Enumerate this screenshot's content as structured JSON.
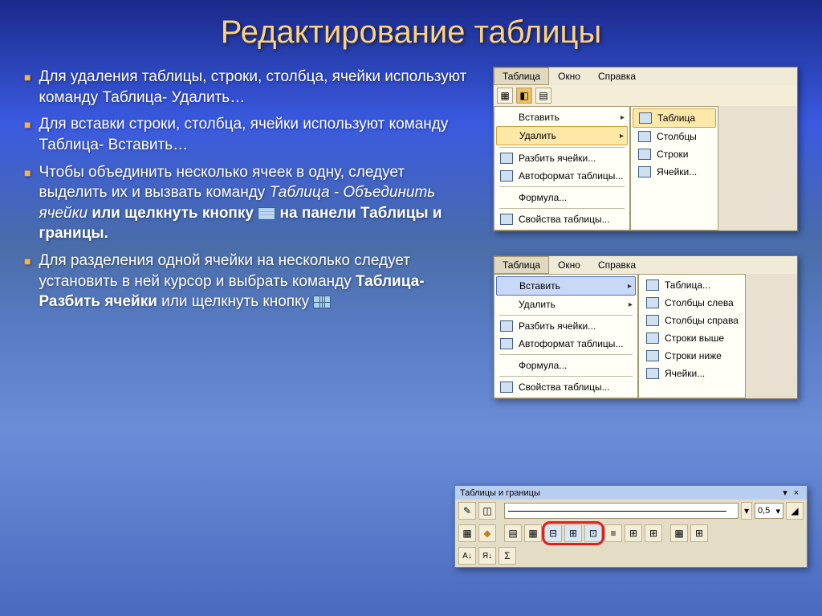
{
  "title": "Редактирование таблицы",
  "bullets": [
    {
      "text": "Для удаления таблицы, строки, столбца, ячейки используют команду Таблица- Удалить…"
    },
    {
      "text": "Для вставки строки, столбца, ячейки используют команду Таблица- Вставить…"
    },
    {
      "text_pre": "Чтобы объединить несколько ячеек в одну, следует выделить их и вызвать команду ",
      "italic": "Таблица - Объединить ячейки",
      "bold_mid": " или щелкнуть кнопку ",
      "icon": "merge",
      "bold_post": " на панели Таблицы и границы."
    },
    {
      "text_pre": "Для разделения одной ячейки на несколько следует установить в ней курсор и выбрать команду ",
      "bold_mid2": "Таблица- Разбить ячейки",
      "post": " или щелкнуть кнопку ",
      "icon": "split"
    }
  ],
  "panel1": {
    "menubar": [
      "Таблица",
      "Окно",
      "Справка"
    ],
    "active_menu": 0,
    "items": [
      {
        "label": "Вставить",
        "arrow": true
      },
      {
        "label": "Удалить",
        "arrow": true,
        "highlight": "highlight"
      },
      {
        "sep": true
      },
      {
        "label": "Разбить ячейки...",
        "icon": "⊞"
      },
      {
        "label": "Автоформат таблицы...",
        "icon": "▤"
      },
      {
        "sep": true
      },
      {
        "label": "Формула..."
      },
      {
        "sep": true
      },
      {
        "label": "Свойства таблицы...",
        "icon": "▦"
      }
    ],
    "submenu": [
      {
        "label": "Таблица",
        "icon": "▦",
        "highlight": "highlight"
      },
      {
        "label": "Столбцы",
        "icon": "⫿"
      },
      {
        "label": "Строки",
        "icon": "≡"
      },
      {
        "label": "Ячейки...",
        "icon": "▭"
      }
    ]
  },
  "panel2": {
    "menubar": [
      "Таблица",
      "Окно",
      "Справка"
    ],
    "active_menu": 0,
    "items": [
      {
        "label": "Вставить",
        "arrow": true,
        "highlight": "highlight-blue"
      },
      {
        "label": "Удалить",
        "arrow": true
      },
      {
        "sep": true
      },
      {
        "label": "Разбить ячейки...",
        "icon": "⊞"
      },
      {
        "label": "Автоформат таблицы...",
        "icon": "▤"
      },
      {
        "sep": true
      },
      {
        "label": "Формула..."
      },
      {
        "sep": true
      },
      {
        "label": "Свойства таблицы...",
        "icon": "▦"
      }
    ],
    "submenu": [
      {
        "label": "Таблица...",
        "icon": "▦"
      },
      {
        "label": "Столбцы слева",
        "icon": "⫿"
      },
      {
        "label": "Столбцы справа",
        "icon": "⫿"
      },
      {
        "label": "Строки выше",
        "icon": "≡"
      },
      {
        "label": "Строки ниже",
        "icon": "≡"
      },
      {
        "label": "Ячейки...",
        "icon": "▭"
      }
    ]
  },
  "toolbar": {
    "title": "Таблицы и границы",
    "weight": "0,5",
    "row1": [
      "✎",
      "◫"
    ],
    "row1_post": [
      "◢"
    ],
    "row2": [
      "▦",
      "◆",
      "▤",
      "▦"
    ],
    "row2_mid": [
      "⊟",
      "⊞",
      "⊡"
    ],
    "row2_end": [
      "≡",
      "⊞",
      "⊞",
      "▦",
      "⊞"
    ],
    "row3": [
      "A↓",
      "Я↓",
      "Σ"
    ]
  }
}
